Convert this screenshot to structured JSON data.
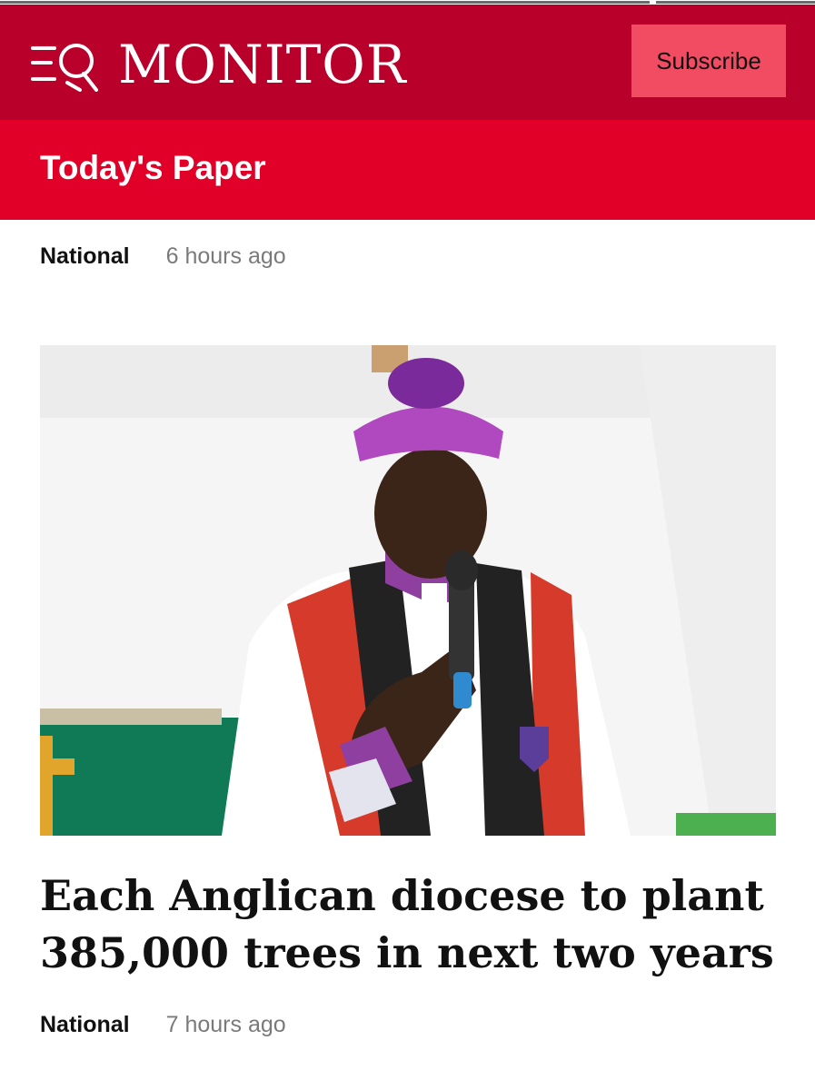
{
  "header": {
    "brand_name": "MONITOR",
    "logo_icon": "nation-media-logo-icon",
    "subscribe_label": "Subscribe"
  },
  "section": {
    "title": "Today's Paper"
  },
  "articles": [
    {
      "category": "National",
      "time": "6 hours ago"
    },
    {
      "category": "National",
      "time": "7 hours ago",
      "headline": "Each Anglican diocese to plant 385,000 trees in next two years",
      "image": "photo-of-bishop-speaking-into-microphone"
    }
  ],
  "colors": {
    "header_bg": "#b8002a",
    "section_bg": "#e00028",
    "subscribe_bg": "#f24c63",
    "meta_time": "#7a7a7a"
  }
}
